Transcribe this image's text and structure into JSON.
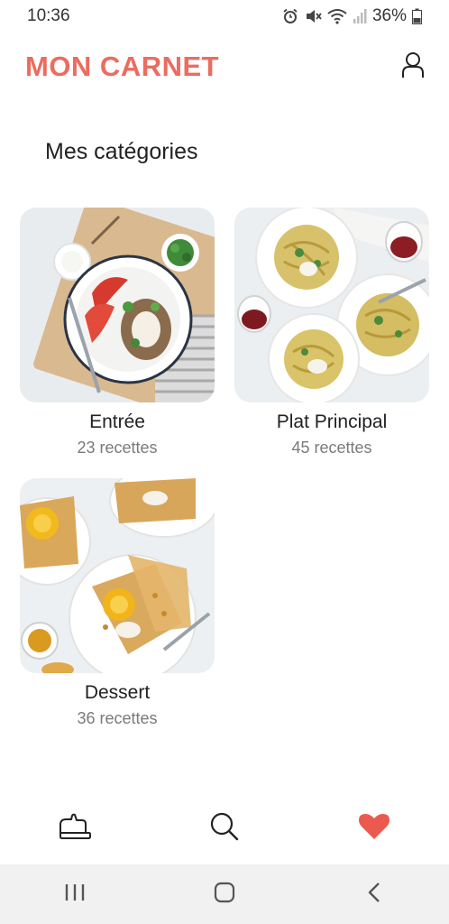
{
  "status_bar": {
    "time": "10:36",
    "battery": "36%",
    "icons": [
      "alarm-icon",
      "mute-icon",
      "wifi-icon",
      "signal-icon",
      "battery-icon"
    ]
  },
  "header": {
    "title": "MON CARNET",
    "profile_icon": "user-icon"
  },
  "section_title": "Mes catégories",
  "categories": [
    {
      "name": "Entrée",
      "count": "23 recettes",
      "image": "salad-plate-photo"
    },
    {
      "name": "Plat Principal",
      "count": "45 recettes",
      "image": "pasta-plates-photo"
    },
    {
      "name": "Dessert",
      "count": "36 recettes",
      "image": "crepes-photo"
    }
  ],
  "tab_bar": {
    "items": [
      "oven-mitt-icon",
      "search-icon",
      "heart-icon"
    ],
    "active": "heart-icon"
  },
  "nav_bar": {
    "items": [
      "recent-apps-icon",
      "home-icon",
      "back-icon"
    ]
  },
  "colors": {
    "brand": "#ec6c5f",
    "text": "#222222",
    "muted": "#7a7a7a",
    "nav_background": "#f1f1f1"
  }
}
